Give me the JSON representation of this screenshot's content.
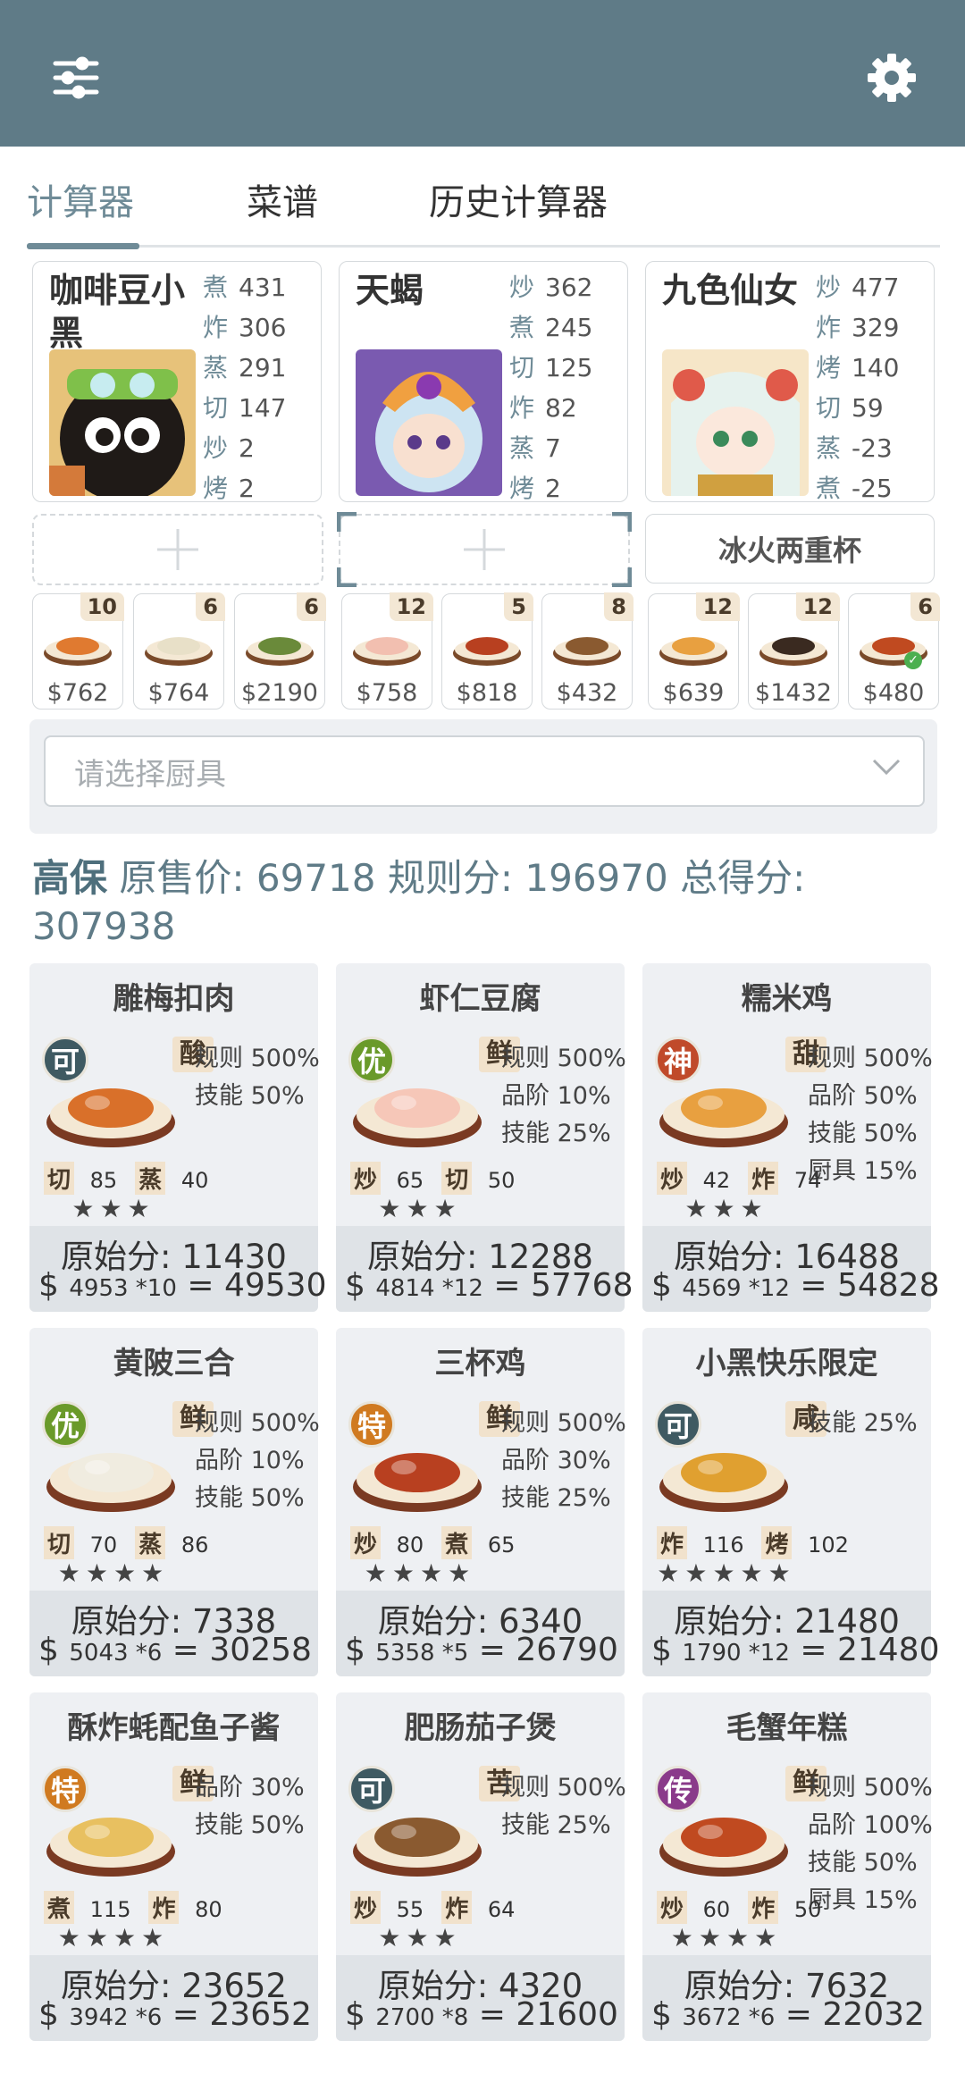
{
  "tabs": [
    "计算器",
    "菜谱",
    "历史计算器"
  ],
  "chefs": [
    {
      "name": "咖啡豆小黑",
      "skills": [
        {
          "k": "煮",
          "v": "431"
        },
        {
          "k": "炸",
          "v": "306"
        },
        {
          "k": "蒸",
          "v": "291"
        },
        {
          "k": "切",
          "v": "147"
        },
        {
          "k": "炒",
          "v": "2"
        },
        {
          "k": "烤",
          "v": "2"
        }
      ]
    },
    {
      "name": "天蝎",
      "skills": [
        {
          "k": "炒",
          "v": "362"
        },
        {
          "k": "煮",
          "v": "245"
        },
        {
          "k": "切",
          "v": "125"
        },
        {
          "k": "炸",
          "v": "82"
        },
        {
          "k": "蒸",
          "v": "7"
        },
        {
          "k": "烤",
          "v": "2"
        }
      ]
    },
    {
      "name": "九色仙女",
      "skills": [
        {
          "k": "炒",
          "v": "477"
        },
        {
          "k": "炸",
          "v": "329"
        },
        {
          "k": "烤",
          "v": "140"
        },
        {
          "k": "切",
          "v": "59"
        },
        {
          "k": "蒸",
          "v": "-23"
        },
        {
          "k": "煮",
          "v": "-25"
        }
      ]
    }
  ],
  "equipment": "冰火两重杯",
  "mini_dishes": [
    {
      "count": "10",
      "price": "$762"
    },
    {
      "count": "6",
      "price": "$764"
    },
    {
      "count": "6",
      "price": "$2190"
    },
    {
      "count": "12",
      "price": "$758"
    },
    {
      "count": "5",
      "price": "$818"
    },
    {
      "count": "8",
      "price": "$432"
    },
    {
      "count": "12",
      "price": "$639"
    },
    {
      "count": "12",
      "price": "$1432"
    },
    {
      "count": "6",
      "price": "$480"
    }
  ],
  "tool_placeholder": "请选择厨具",
  "summary": {
    "title": "高保",
    "text1": "原售价:",
    "v1": "69718",
    "text2": "规则分:",
    "v2": "196970",
    "text3": "总得分:",
    "v3": "307938"
  },
  "recipes": [
    {
      "name": "雕梅扣肉",
      "rarity": "可",
      "rc": "#3f5a62",
      "flavor": "酸",
      "bonus": [
        "规则 500%",
        "技能 50%"
      ],
      "skills": [
        {
          "k": "切",
          "v": "85"
        },
        {
          "k": "蒸",
          "v": "40"
        }
      ],
      "stars": "★★★",
      "orig": "原始分: 11430",
      "unit": "4953 *10",
      "total": "49530",
      "dish": "#d9702a"
    },
    {
      "name": "虾仁豆腐",
      "rarity": "优",
      "rc": "#6a9a2a",
      "flavor": "鲜",
      "bonus": [
        "规则 500%",
        "品阶 10%",
        "技能 25%"
      ],
      "skills": [
        {
          "k": "炒",
          "v": "65"
        },
        {
          "k": "切",
          "v": "50"
        }
      ],
      "stars": "★★★",
      "orig": "原始分: 12288",
      "unit": "4814 *12",
      "total": "57768",
      "dish": "#f6c7b8"
    },
    {
      "name": "糯米鸡",
      "rarity": "神",
      "rc": "#c04a2a",
      "flavor": "甜",
      "bonus": [
        "规则 500%",
        "品阶 50%",
        "技能 50%",
        "厨具 15%"
      ],
      "skills": [
        {
          "k": "炒",
          "v": "42"
        },
        {
          "k": "炸",
          "v": "74"
        }
      ],
      "stars": "★★★",
      "orig": "原始分: 16488",
      "unit": "4569 *12",
      "total": "54828",
      "dish": "#e8a040"
    },
    {
      "name": "黄陂三合",
      "rarity": "优",
      "rc": "#6a9a2a",
      "flavor": "鲜",
      "bonus": [
        "规则 500%",
        "品阶 10%",
        "技能 50%"
      ],
      "skills": [
        {
          "k": "切",
          "v": "70"
        },
        {
          "k": "蒸",
          "v": "86"
        }
      ],
      "stars": "★★★★",
      "orig": "原始分: 7338",
      "unit": "5043 *6",
      "total": "30258",
      "dish": "#f0ece0"
    },
    {
      "name": "三杯鸡",
      "rarity": "特",
      "rc": "#d07a20",
      "flavor": "鲜",
      "bonus": [
        "规则 500%",
        "品阶 30%",
        "技能 25%"
      ],
      "skills": [
        {
          "k": "炒",
          "v": "80"
        },
        {
          "k": "煮",
          "v": "65"
        }
      ],
      "stars": "★★★★",
      "orig": "原始分: 6340",
      "unit": "5358 *5",
      "total": "26790",
      "dish": "#b84020"
    },
    {
      "name": "小黑快乐限定",
      "rarity": "可",
      "rc": "#3f5a62",
      "flavor": "咸",
      "bonus": [
        "技能 25%"
      ],
      "skills": [
        {
          "k": "炸",
          "v": "116"
        },
        {
          "k": "烤",
          "v": "102"
        }
      ],
      "stars": "★★★★★",
      "orig": "原始分: 21480",
      "unit": "1790 *12",
      "total": "21480",
      "dish": "#e0a030"
    },
    {
      "name": "酥炸蚝配鱼子酱",
      "rarity": "特",
      "rc": "#d07a20",
      "flavor": "鲜",
      "bonus": [
        "品阶 30%",
        "技能 50%"
      ],
      "skills": [
        {
          "k": "煮",
          "v": "115"
        },
        {
          "k": "炸",
          "v": "80"
        }
      ],
      "stars": "★★★★",
      "orig": "原始分: 23652",
      "unit": "3942 *6",
      "total": "23652",
      "dish": "#e8c060"
    },
    {
      "name": "肥肠茄子煲",
      "rarity": "可",
      "rc": "#3f5a62",
      "flavor": "苦",
      "bonus": [
        "规则 500%",
        "技能 25%"
      ],
      "skills": [
        {
          "k": "炒",
          "v": "55"
        },
        {
          "k": "炸",
          "v": "64"
        }
      ],
      "stars": "★★★",
      "orig": "原始分: 4320",
      "unit": "2700 *8",
      "total": "21600",
      "dish": "#8a5a30"
    },
    {
      "name": "毛蟹年糕",
      "rarity": "传",
      "rc": "#8a3a8a",
      "flavor": "鲜",
      "bonus": [
        "规则 500%",
        "品阶 100%",
        "技能 50%",
        "厨具 15%"
      ],
      "skills": [
        {
          "k": "炒",
          "v": "60"
        },
        {
          "k": "炸",
          "v": "50"
        }
      ],
      "stars": "★★★★",
      "orig": "原始分: 7632",
      "unit": "3672 *6",
      "total": "22032",
      "dish": "#c04a20"
    }
  ]
}
